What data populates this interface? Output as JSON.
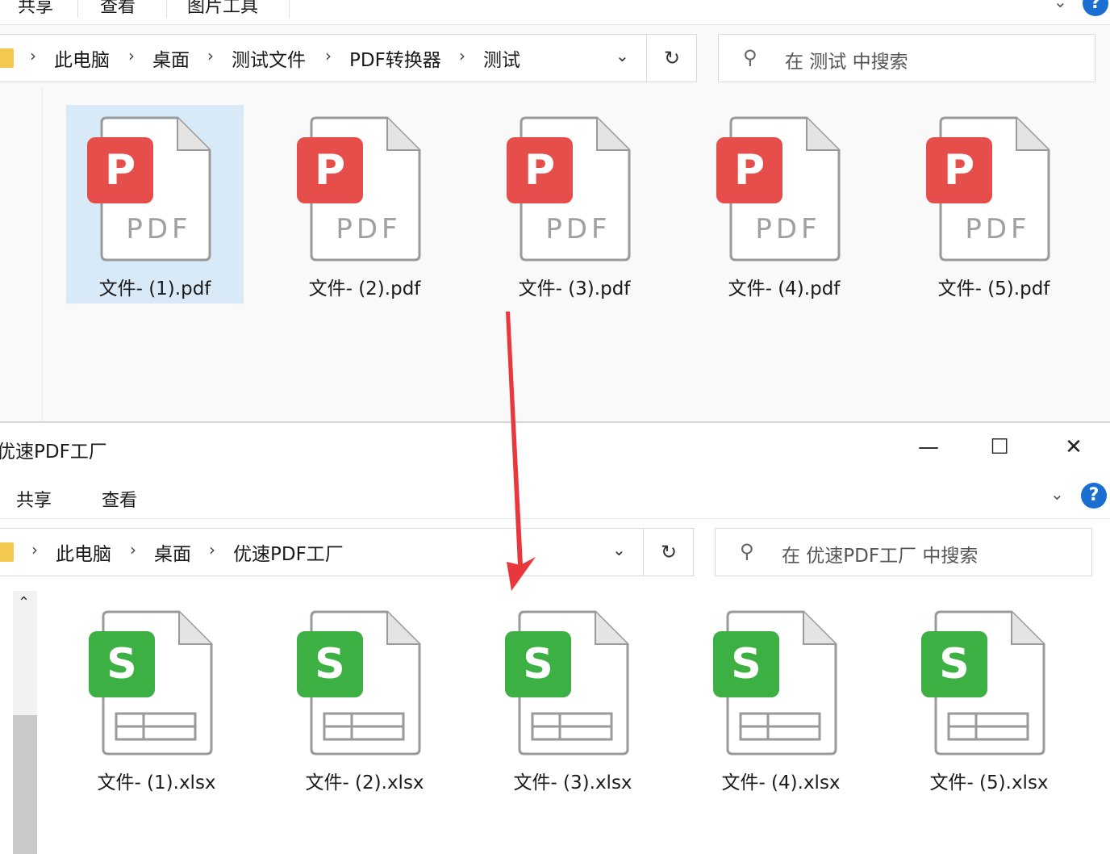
{
  "top_window": {
    "ribbon_tabs": [
      "共享",
      "查看",
      "图片工具"
    ],
    "help_label": "?",
    "breadcrumb": [
      "此电脑",
      "桌面",
      "测试文件",
      "PDF转换器",
      "测试"
    ],
    "search_placeholder": "在 测试 中搜索",
    "files": [
      {
        "name": "文件- (1).pdf",
        "badge": "P",
        "type_label": "PDF"
      },
      {
        "name": "文件- (2).pdf",
        "badge": "P",
        "type_label": "PDF"
      },
      {
        "name": "文件- (3).pdf",
        "badge": "P",
        "type_label": "PDF"
      },
      {
        "name": "文件- (4).pdf",
        "badge": "P",
        "type_label": "PDF"
      },
      {
        "name": "文件- (5).pdf",
        "badge": "P",
        "type_label": "PDF"
      }
    ]
  },
  "bottom_window": {
    "title": "优速PDF工厂",
    "controls": {
      "minimize": "—",
      "maximize": "☐",
      "close": "✕"
    },
    "ribbon_tabs": [
      "共享",
      "查看"
    ],
    "help_label": "?",
    "breadcrumb": [
      "此电脑",
      "桌面",
      "优速PDF工厂"
    ],
    "search_placeholder": "在 优速PDF工厂 中搜索",
    "files": [
      {
        "name": "文件- (1).xlsx",
        "badge": "S"
      },
      {
        "name": "文件- (2).xlsx",
        "badge": "S"
      },
      {
        "name": "文件- (3).xlsx",
        "badge": "S"
      },
      {
        "name": "文件- (4).xlsx",
        "badge": "S"
      },
      {
        "name": "文件- (5).xlsx",
        "badge": "S"
      }
    ]
  },
  "icons": {
    "refresh": "↻",
    "search": "⚲",
    "chevron_down": "⌄",
    "chevron_right": "›",
    "scroll_up": "⌃"
  },
  "colors": {
    "pdf_badge": "#e54e4a",
    "xlsx_badge": "#3cb043",
    "selection": "#cce4f7",
    "arrow": "#e8383d",
    "help": "#1a6fd1",
    "folder": "#f3c84e"
  }
}
